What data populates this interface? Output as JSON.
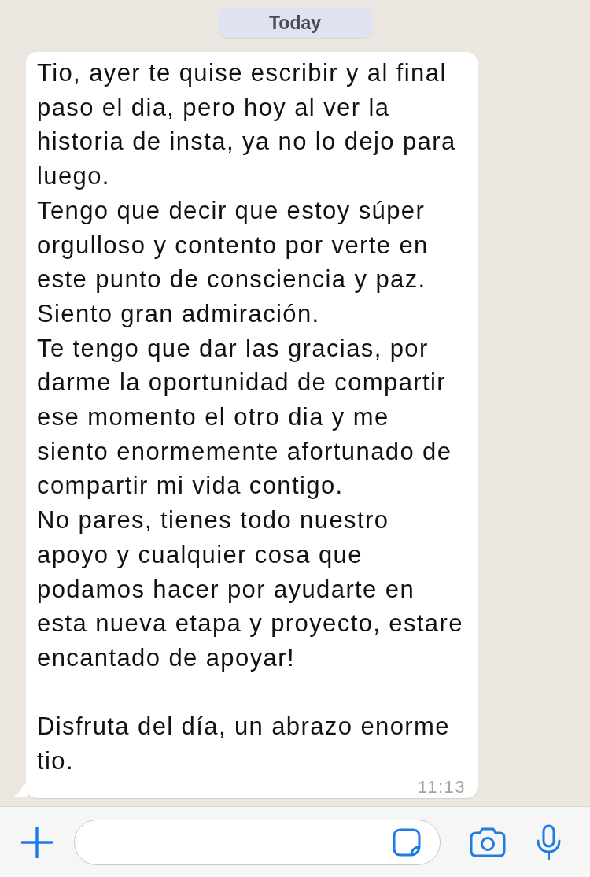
{
  "date_chip": "Today",
  "message": {
    "text": "Tio, ayer te quise escribir y al final paso el dia, pero hoy al ver la historia de insta, ya no lo dejo para luego.\nTengo que decir que estoy súper orgulloso y contento por verte en este punto de consciencia y paz.\nSiento gran admiración.\nTe tengo que dar las gracias, por darme la oportunidad de compartir ese momento el otro dia y me siento enormemente afortunado de compartir mi vida contigo.\nNo pares, tienes todo nuestro apoyo y cualquier cosa que podamos hacer por ayudarte en esta nueva etapa y proyecto, estare encantado de apoyar!\n\nDisfruta del día, un abrazo enorme tio.",
    "time": "11:13"
  }
}
